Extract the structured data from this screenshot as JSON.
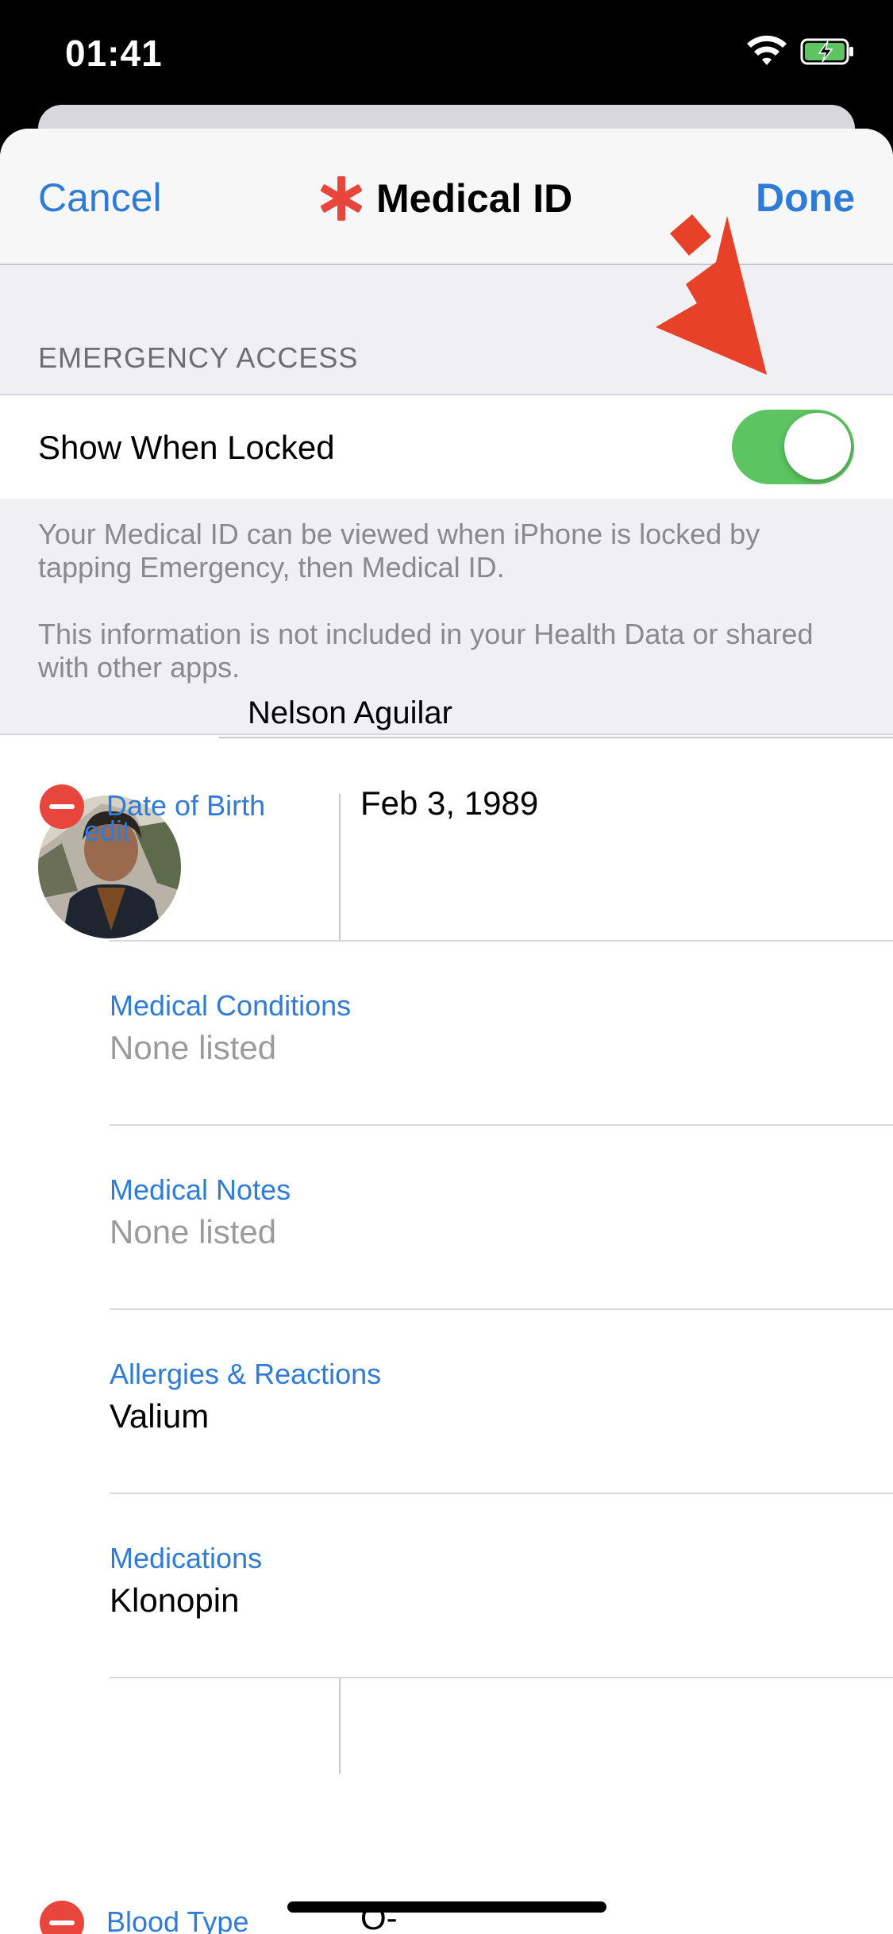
{
  "status_bar": {
    "time": "01:41",
    "wifi_icon": "wifi-icon",
    "battery_icon": "battery-charging-icon"
  },
  "nav": {
    "cancel_label": "Cancel",
    "title": "Medical ID",
    "title_icon": "medical-star-icon",
    "done_label": "Done"
  },
  "emergency": {
    "section_header": "EMERGENCY ACCESS",
    "toggle_label": "Show When Locked",
    "toggle_on": true,
    "footer_1": "Your Medical ID can be viewed when iPhone is locked by tapping Emergency, then Medical ID.",
    "footer_2": "This information is not included in your Health Data or shared with other apps."
  },
  "profile": {
    "name": "Nelson Aguilar",
    "edit_label": "edit"
  },
  "fields": {
    "dob_label": "Date of Birth",
    "dob_value": "Feb 3, 1989",
    "conditions_label": "Medical Conditions",
    "conditions_value": "None listed",
    "notes_label": "Medical Notes",
    "notes_value": "None listed",
    "allergies_label": "Allergies & Reactions",
    "allergies_value": "Valium",
    "medications_label": "Medications",
    "medications_value": "Klonopin",
    "blood_label": "Blood Type",
    "blood_value": "O-"
  },
  "colors": {
    "accent": "#2f7bd8",
    "toggle_green": "#5cc460",
    "destructive": "#e8453c",
    "annotation_arrow": "#e8412a"
  }
}
